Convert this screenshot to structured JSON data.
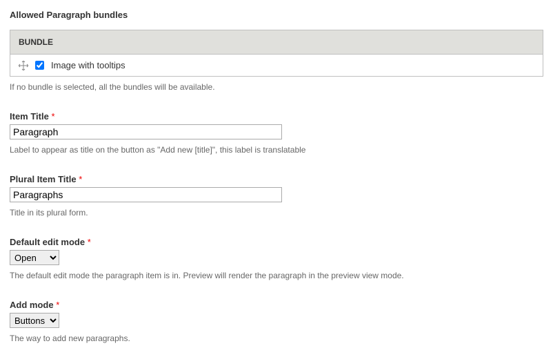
{
  "section": {
    "heading": "Allowed Paragraph bundles",
    "table_header": "BUNDLE",
    "row": {
      "checked": true,
      "label": "Image with tooltips"
    },
    "help": "If no bundle is selected, all the bundles will be available."
  },
  "item_title": {
    "label": "Item Title",
    "value": "Paragraph",
    "help": "Label to appear as title on the button as \"Add new [title]\", this label is translatable"
  },
  "plural_item_title": {
    "label": "Plural Item Title",
    "value": "Paragraphs",
    "help": "Title in its plural form."
  },
  "default_edit_mode": {
    "label": "Default edit mode",
    "value": "Open",
    "help": "The default edit mode the paragraph item is in. Preview will render the paragraph in the preview view mode."
  },
  "add_mode": {
    "label": "Add mode",
    "value": "Buttons",
    "help": "The way to add new paragraphs."
  }
}
